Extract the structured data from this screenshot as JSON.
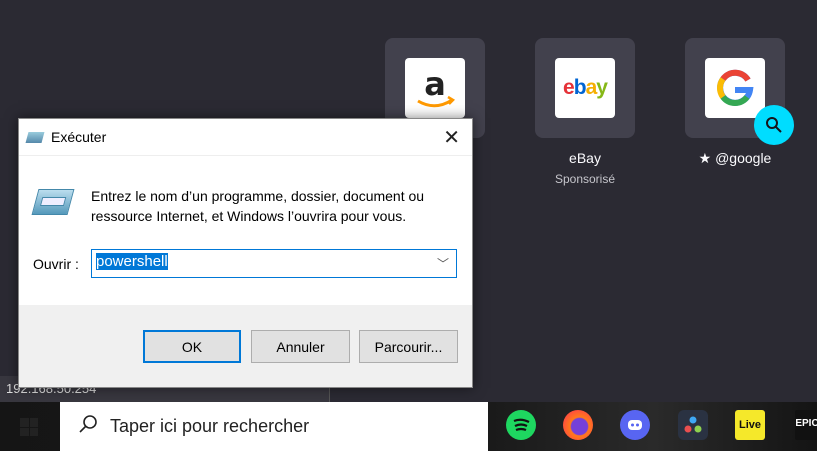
{
  "newtab": {
    "tiles": [
      {
        "name": "amazon",
        "label": "",
        "sublabel": ""
      },
      {
        "name": "ebay",
        "label": "eBay",
        "sublabel": "Sponsorisé"
      },
      {
        "name": "google",
        "label": "@google",
        "sublabel": ""
      }
    ]
  },
  "status_bar": {
    "text": "192.168.50.254"
  },
  "dialog": {
    "title": "Exécuter",
    "description": "Entrez le nom d’un programme, dossier, document ou ressource Internet, et Windows l’ouvrira pour vous.",
    "open_label": "Ouvrir :",
    "open_value": "powershell",
    "buttons": {
      "ok": "OK",
      "cancel": "Annuler",
      "browse": "Parcourir..."
    }
  },
  "taskbar": {
    "search_placeholder": "Taper ici pour rechercher",
    "apps": [
      "spotify",
      "firefox",
      "discord",
      "davinci-resolve",
      "ableton-live",
      "epic-games"
    ],
    "live_label": "Live",
    "epic_label": "EPIC"
  },
  "colors": {
    "accent": "#0078d7",
    "search_badge": "#00ddff"
  }
}
